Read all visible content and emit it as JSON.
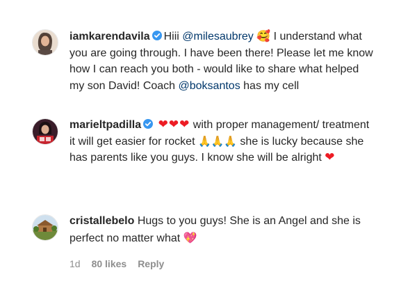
{
  "comments": [
    {
      "username": "iamkarendavila",
      "verified": true,
      "text_1": "Hiii ",
      "mention_1": "@milesaubrey",
      "emoji_1": "🥰",
      "text_2": " I understand what you are going through. I have been there! Please let me know how I can reach you both - would like to share what helped my son David! Coach ",
      "mention_2": "@boksantos",
      "text_3": " has my cell"
    },
    {
      "username": "marieltpadilla",
      "verified": true,
      "hearts": "❤❤❤",
      "text_1": " with proper management/ treatment it will get easier for rocket ",
      "pray_emojis": "🙏🙏🙏",
      "text_2": " she is lucky because she has parents like you guys. I know she will be alright ",
      "heart_end": "❤"
    },
    {
      "username": "cristallebelo",
      "verified": false,
      "text_1": " Hugs to you guys! She is an Angel and she is perfect no matter what ",
      "emoji_end": "💖",
      "meta": {
        "time": "1d",
        "likes": "80 likes",
        "reply": "Reply"
      }
    }
  ],
  "icons": {
    "verified": "verified-badge-icon",
    "accent": "#3897f0",
    "heart_color": "#ed1c24",
    "mention_color": "#00376b"
  }
}
